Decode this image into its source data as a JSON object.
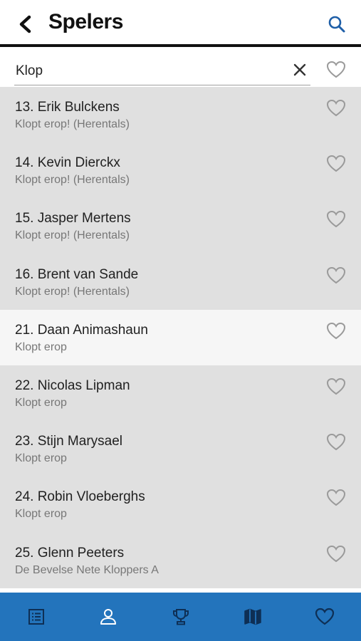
{
  "header": {
    "title": "Spelers",
    "back_icon": "chevron-left-icon",
    "search_icon": "search-icon",
    "search_icon_color": "#1f5fa8"
  },
  "search": {
    "value": "Klop",
    "clear_icon": "close-icon",
    "favorite_filter_icon": "heart-outline-icon"
  },
  "players": [
    {
      "name": "13. Erik Bulckens",
      "team": "Klopt erop! (Herentals)",
      "highlighted": false
    },
    {
      "name": "14. Kevin Dierckx",
      "team": "Klopt erop! (Herentals)",
      "highlighted": false
    },
    {
      "name": "15. Jasper Mertens",
      "team": "Klopt erop! (Herentals)",
      "highlighted": false
    },
    {
      "name": "16. Brent van Sande",
      "team": "Klopt erop! (Herentals)",
      "highlighted": false
    },
    {
      "name": "21. Daan Animashaun",
      "team": "Klopt erop",
      "highlighted": true
    },
    {
      "name": "22. Nicolas Lipman",
      "team": "Klopt erop",
      "highlighted": false
    },
    {
      "name": "23. Stijn Marysael",
      "team": "Klopt erop",
      "highlighted": false
    },
    {
      "name": "24. Robin Vloeberghs",
      "team": "Klopt erop",
      "highlighted": false
    },
    {
      "name": "25. Glenn Peeters",
      "team": "De Bevelse Nete Kloppers A",
      "highlighted": false
    }
  ],
  "bottom_nav": {
    "background": "#2374bc",
    "items": [
      {
        "icon": "list-icon",
        "active": false
      },
      {
        "icon": "person-icon",
        "active": true
      },
      {
        "icon": "trophy-icon",
        "active": false
      },
      {
        "icon": "map-icon",
        "active": false
      },
      {
        "icon": "heart-icon",
        "active": false
      }
    ]
  }
}
